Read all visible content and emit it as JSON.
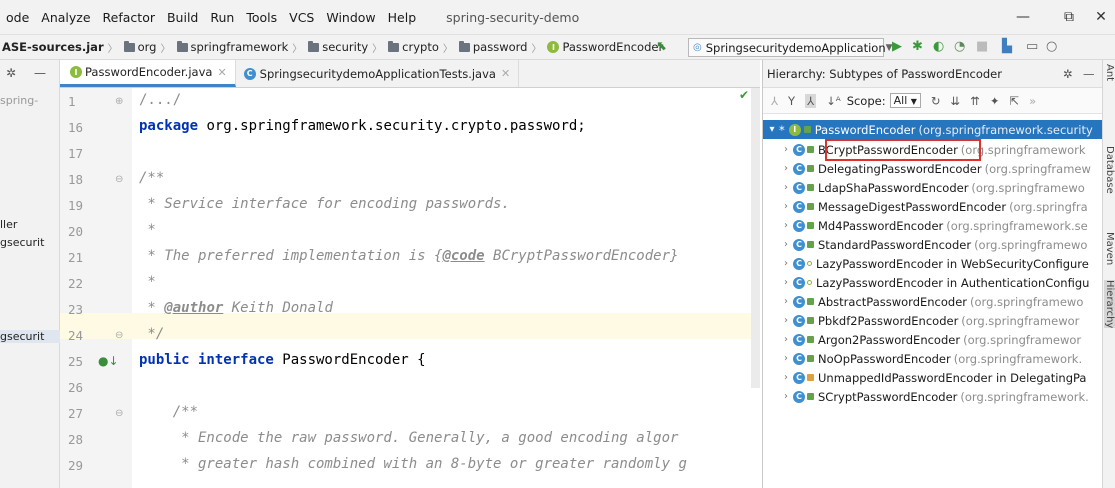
{
  "menu": {
    "items": [
      "ode",
      "Analyze",
      "Refactor",
      "Build",
      "Run",
      "Tools",
      "VCS",
      "Window",
      "Help"
    ],
    "window_title": "spring-security-demo"
  },
  "window_controls": {
    "minimize": "—",
    "maximize": "⧉",
    "close": "✕"
  },
  "breadcrumb": {
    "jar": "ASE-sources.jar",
    "parts": [
      "org",
      "springframework",
      "security",
      "crypto",
      "password",
      "PasswordEncoder"
    ]
  },
  "run_config": {
    "label": "SpringsecuritydemoApplication"
  },
  "left_strip": {
    "lines": [
      "spring-",
      "ller",
      "gsecurit",
      "gsecurit"
    ]
  },
  "tabs": [
    {
      "label": "PasswordEncoder.java",
      "icon": "interface-icon",
      "active": true
    },
    {
      "label": "SpringsecuritydemoApplicationTests.java",
      "icon": "class-icon",
      "active": false
    }
  ],
  "editor": {
    "lines": [
      {
        "no": "1",
        "text": "/.../"
      },
      {
        "no": "16",
        "kw": "package",
        "text": " org.springframework.security.crypto.password;"
      },
      {
        "no": "17",
        "text": ""
      },
      {
        "no": "18",
        "text": "/**"
      },
      {
        "no": "19",
        "text": " * Service interface for encoding passwords."
      },
      {
        "no": "20",
        "text": " *"
      },
      {
        "no": "21",
        "pre": " * The preferred implementation is {",
        "tag": "@code",
        "post": " BCryptPasswordEncoder}"
      },
      {
        "no": "22",
        "text": " *"
      },
      {
        "no": "23",
        "pre": " * ",
        "tag": "@author",
        "post": " Keith Donald"
      },
      {
        "no": "24",
        "text": " */"
      },
      {
        "no": "25",
        "kw": "public interface",
        "text": " PasswordEncoder {"
      },
      {
        "no": "26",
        "text": ""
      },
      {
        "no": "27",
        "text": "    /**"
      },
      {
        "no": "28",
        "text": "     * Encode the raw password. Generally, a good encoding algor"
      },
      {
        "no": "29",
        "text": "     * greater hash combined with an 8-byte or greater randomly g"
      }
    ]
  },
  "hierarchy": {
    "title": "Hierarchy: Subtypes of PasswordEncoder",
    "scope_label": "Scope:",
    "scope_value": "All",
    "root": {
      "name": "PasswordEncoder",
      "pkg": "(org.springframework.security"
    },
    "items": [
      {
        "name": "BCryptPasswordEncoder",
        "pkg": "(org.springframework",
        "vis": "public"
      },
      {
        "name": "DelegatingPasswordEncoder",
        "pkg": "(org.springframew",
        "vis": "public"
      },
      {
        "name": "LdapShaPasswordEncoder",
        "pkg": "(org.springframewo",
        "vis": "public"
      },
      {
        "name": "MessageDigestPasswordEncoder",
        "pkg": "(org.springfra",
        "vis": "public"
      },
      {
        "name": "Md4PasswordEncoder",
        "pkg": "(org.springframework.se",
        "vis": "public"
      },
      {
        "name": "StandardPasswordEncoder",
        "pkg": "(org.springframewo",
        "vis": "public"
      },
      {
        "name": "LazyPasswordEncoder in WebSecurityConfigure",
        "pkg": "",
        "vis": "package"
      },
      {
        "name": "LazyPasswordEncoder in AuthenticationConfigu",
        "pkg": "",
        "vis": "package"
      },
      {
        "name": "AbstractPasswordEncoder",
        "pkg": "(org.springframewo",
        "vis": "public"
      },
      {
        "name": "Pbkdf2PasswordEncoder",
        "pkg": "(org.springframewor",
        "vis": "public"
      },
      {
        "name": "Argon2PasswordEncoder",
        "pkg": "(org.springframewor",
        "vis": "public"
      },
      {
        "name": "NoOpPasswordEncoder",
        "pkg": "(org.springframework.",
        "vis": "public"
      },
      {
        "name": "UnmappedIdPasswordEncoder in DelegatingPa",
        "pkg": "",
        "vis": "private"
      },
      {
        "name": "SCryptPasswordEncoder",
        "pkg": "(org.springframework.",
        "vis": "public"
      }
    ]
  },
  "right_strip": {
    "labels": [
      "Ant",
      "Database",
      "Maven",
      "Hierarchy"
    ]
  }
}
